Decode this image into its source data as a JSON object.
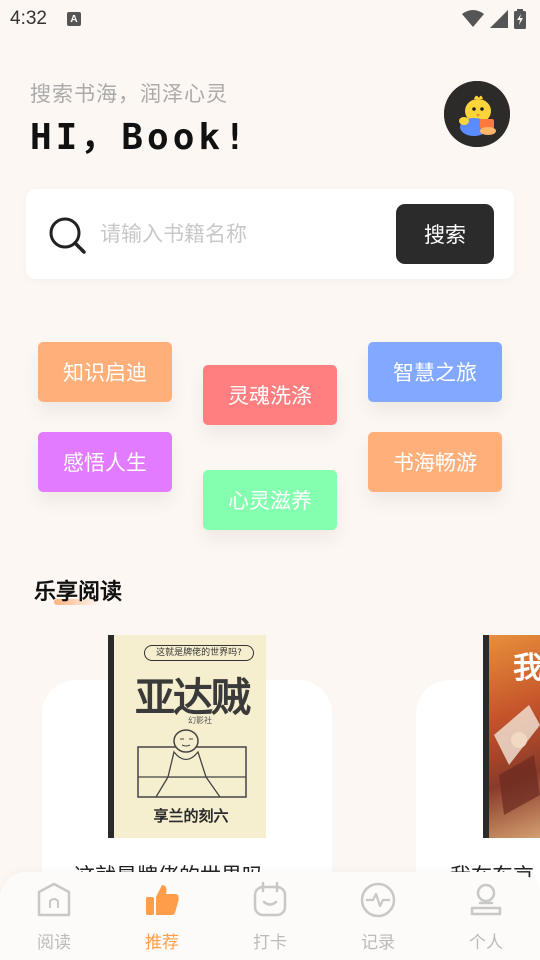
{
  "status_bar": {
    "time": "4:32",
    "notification_badge": "A"
  },
  "header": {
    "subtitle": "搜索书海，润泽心灵",
    "title": "HI，Book!"
  },
  "search": {
    "placeholder": "请输入书籍名称",
    "button_label": "搜索"
  },
  "tags": [
    {
      "label": "知识启迪",
      "color": "#ffb07a"
    },
    {
      "label": "灵魂洗涤",
      "color": "#ff7f80"
    },
    {
      "label": "智慧之旅",
      "color": "#82a9ff"
    },
    {
      "label": "感悟人生",
      "color": "#e27bff"
    },
    {
      "label": "心灵滋养",
      "color": "#84ffb0"
    },
    {
      "label": "书海畅游",
      "color": "#ffb07a"
    }
  ],
  "section": {
    "title": "乐享阅读"
  },
  "books": [
    {
      "title": "这就是牌佬的世界吗",
      "cover_top_text": "这就是牌佬的世界吗?",
      "cover_main_text": "亚达贼",
      "cover_author": "幻影社",
      "cover_bottom_text": "享兰的刻六"
    },
    {
      "title": "我在东京",
      "cover_main_text": "我"
    }
  ],
  "nav": {
    "items": [
      {
        "label": "阅读",
        "icon": "reading-icon",
        "active": false
      },
      {
        "label": "推荐",
        "icon": "thumbs-up-icon",
        "active": true
      },
      {
        "label": "打卡",
        "icon": "check-in-icon",
        "active": false
      },
      {
        "label": "记录",
        "icon": "activity-icon",
        "active": false
      },
      {
        "label": "个人",
        "icon": "profile-icon",
        "active": false
      }
    ]
  },
  "colors": {
    "accent": "#ff9d4a",
    "background": "#fdf7f3",
    "button": "#2b2b2b"
  }
}
